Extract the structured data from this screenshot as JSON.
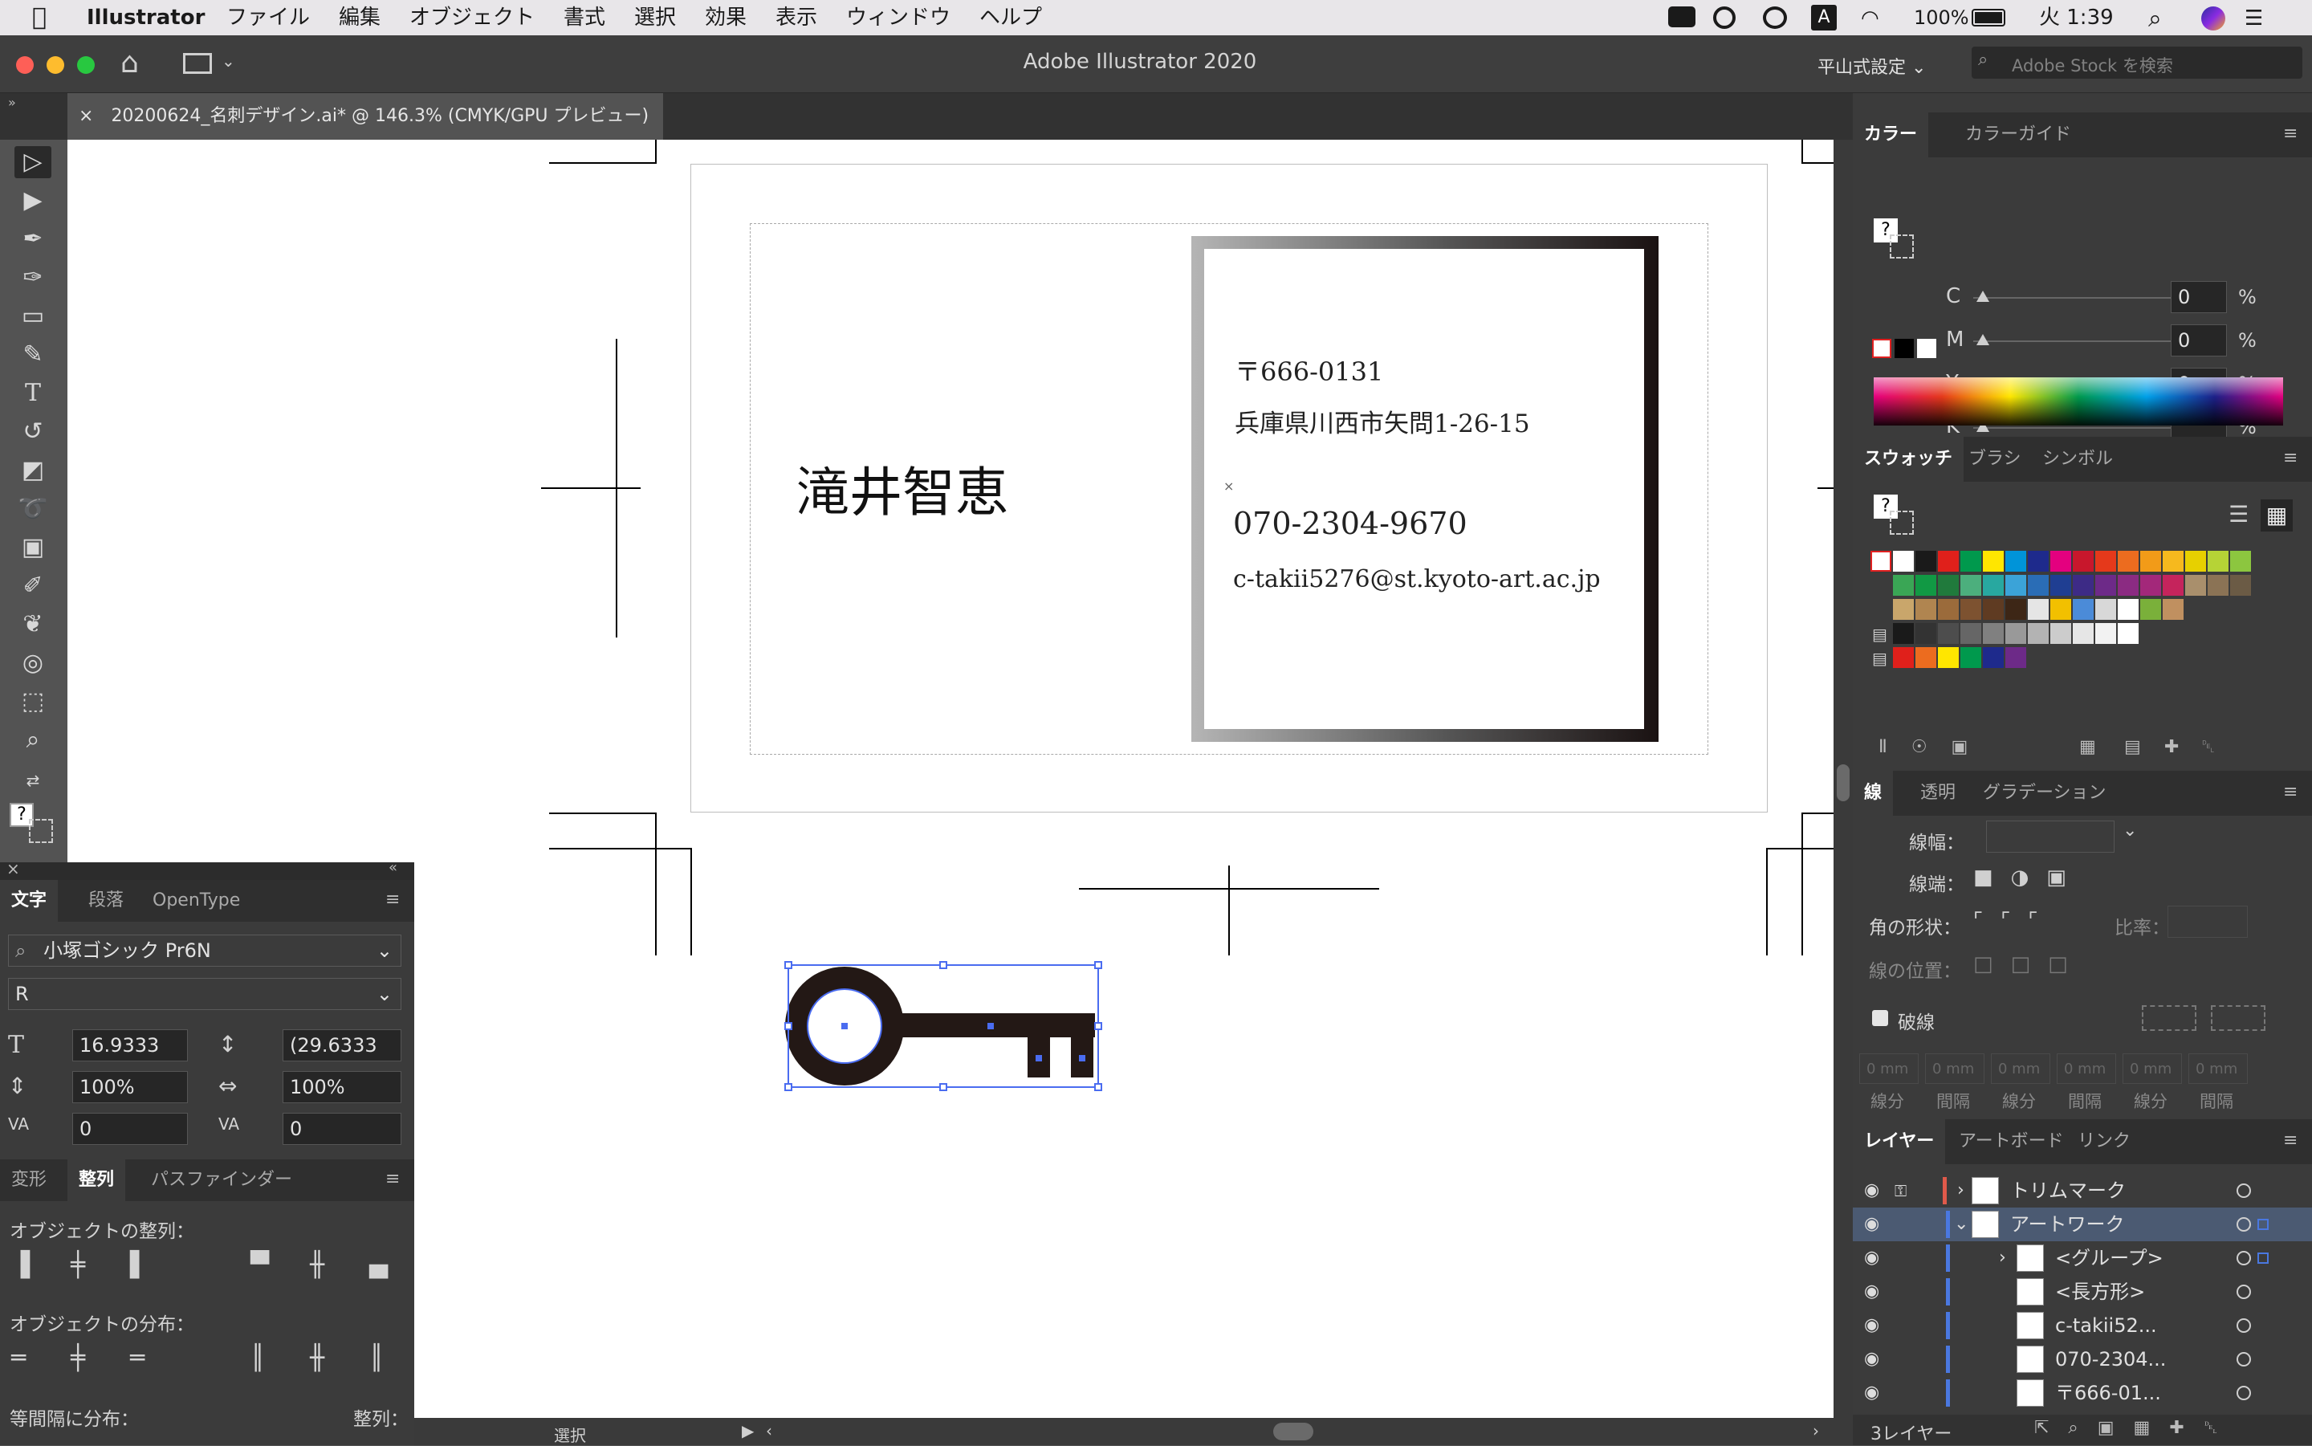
{
  "menubar": {
    "apple": "",
    "items": [
      "Illustrator",
      "ファイル",
      "編集",
      "オブジェクト",
      "書式",
      "選択",
      "効果",
      "表示",
      "ウィンドウ",
      "ヘルプ"
    ],
    "battery": "100%",
    "clock": "火 1:39"
  },
  "titlebar": {
    "title": "Adobe Illustrator 2020",
    "workspace": "平山式設定",
    "stock_placeholder": "Adobe Stock を検索"
  },
  "document_tab": {
    "label": "20200624_名刺デザイン.ai* @ 146.3% (CMYK/GPU プレビュー)",
    "close": "×"
  },
  "card": {
    "name": "滝井智恵",
    "postal": "〒666-0131",
    "address": "兵庫県川西市矢問1-26-15",
    "phone": "070-2304-9670",
    "email": "c-takii5276@st.kyoto-art.ac.jp"
  },
  "color_panel": {
    "tabs": [
      "カラー",
      "カラーガイド"
    ],
    "channels": [
      {
        "label": "C",
        "value": "0",
        "unit": "%"
      },
      {
        "label": "M",
        "value": "0",
        "unit": "%"
      },
      {
        "label": "Y",
        "value": "0",
        "unit": "%"
      },
      {
        "label": "K",
        "value": "",
        "unit": "%"
      }
    ]
  },
  "swatch_panel": {
    "tabs": [
      "スウォッチ",
      "ブラシ",
      "シンボル"
    ],
    "rows": [
      [
        "#ffffff",
        "#1a1a1a",
        "#e0201b",
        "#00994d",
        "#ffe600",
        "#0094d9",
        "#1e2a8c",
        "#e4007f",
        "#c8172c",
        "#e5391b",
        "#ec6c1f",
        "#f29b18",
        "#f6b91e",
        "#e7d000",
        "#b6d336",
        "#8cc63f"
      ],
      [
        "#3aa655",
        "#119944",
        "#207a3c",
        "#4caf7d",
        "#28a8a0",
        "#3ba3d8",
        "#2a6db6",
        "#1f3e92",
        "#3d2b86",
        "#6d2a88",
        "#8b2b82",
        "#a3287a",
        "#c5245c",
        "#a98f6c",
        "#8b7355",
        "#6b5b45"
      ],
      [
        "#c9a66b",
        "#b08550",
        "#9b6b3b",
        "#7d5230",
        "#5f3b22",
        "#3d2616",
        "#e5e5e5",
        "#f2c000",
        "#4b8bd8",
        "#d8d8d8",
        "#ffffff",
        "#7ab03a",
        "#c09060"
      ],
      [
        "#1a1a1a",
        "#333333",
        "#4d4d4d",
        "#666666",
        "#808080",
        "#999999",
        "#b3b3b3",
        "#cccccc",
        "#e6e6e6",
        "#f2f2f2",
        "#ffffff"
      ],
      [
        "#e0201b",
        "#ec6c1f",
        "#ffe600",
        "#00994d",
        "#1e2a8c",
        "#6d2a88"
      ]
    ]
  },
  "stroke_panel": {
    "tabs": [
      "線",
      "透明",
      "グラデーション"
    ],
    "weight_label": "線幅：",
    "cap_label": "線端：",
    "corner_label": "角の形状：",
    "ratio_label": "比率：",
    "align_label": "線の位置：",
    "dash_label": "破線",
    "dash_fields": [
      "0 mm",
      "0 mm",
      "0 mm",
      "0 mm",
      "0 mm",
      "0 mm"
    ],
    "dash_captions": [
      "線分",
      "間隔",
      "線分",
      "間隔",
      "線分",
      "間隔"
    ]
  },
  "layers_panel": {
    "tabs": [
      "レイヤー",
      "アートボード",
      "リンク"
    ],
    "rows": [
      {
        "name": "トリムマーク",
        "color": "#e05a4a"
      },
      {
        "name": "アートワーク",
        "color": "#4a78e0"
      },
      {
        "name": "<グループ>",
        "color": "#4a78e0"
      },
      {
        "name": "<長方形>",
        "color": "#4a78e0"
      },
      {
        "name": "c-takii52...",
        "color": "#4a78e0"
      },
      {
        "name": "070-2304...",
        "color": "#4a78e0"
      },
      {
        "name": "〒666-01...",
        "color": "#4a78e0"
      }
    ],
    "footer": "3レイヤー"
  },
  "char_panel": {
    "tabs": [
      "文字",
      "段落",
      "OpenType"
    ],
    "font": "小塚ゴシック Pr6N",
    "style": "R",
    "size": "16.9333",
    "leading": "(29.6333",
    "vscale": "100%",
    "hscale": "100%",
    "kerning": "0",
    "tracking": "0"
  },
  "align_panel": {
    "tabs": [
      "変形",
      "整列",
      "パスファインダー"
    ],
    "align_label": "オブジェクトの整列：",
    "dist_label": "オブジェクトの分布：",
    "spacing_label": "等間隔に分布：",
    "align_to_label": "整列："
  },
  "statusbar": {
    "mode": "選択"
  }
}
